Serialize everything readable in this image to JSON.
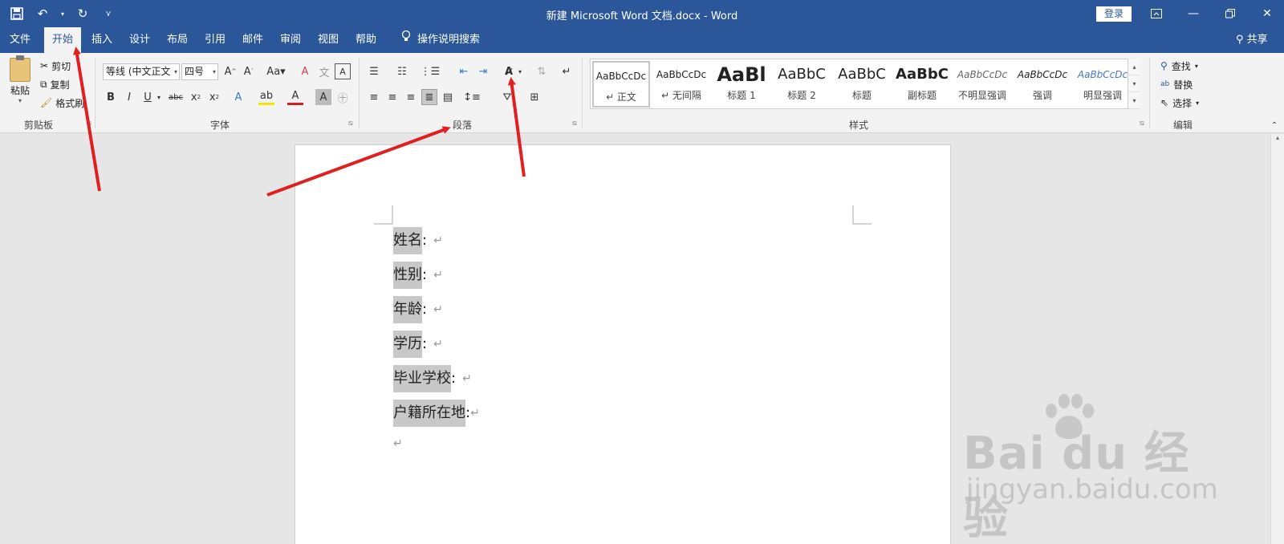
{
  "titlebar": {
    "doc_title": "新建 Microsoft Word 文档.docx  -  Word",
    "login": "登录",
    "bg": "#2b579a"
  },
  "menu": {
    "tabs": [
      "文件",
      "开始",
      "插入",
      "设计",
      "布局",
      "引用",
      "邮件",
      "审阅",
      "视图",
      "帮助"
    ],
    "active": "开始",
    "tell_me": "操作说明搜索",
    "share": "共享"
  },
  "clipboard": {
    "paste": "粘贴",
    "cut": "剪切",
    "copy": "复制",
    "format_painter": "格式刷",
    "group": "剪贴板"
  },
  "font": {
    "name": "等线 (中文正文",
    "size": "四号",
    "group": "字体"
  },
  "paragraph": {
    "group": "段落"
  },
  "styles": {
    "group": "样式",
    "items": [
      {
        "preview": "AaBbCcDc",
        "name": "↵ 正文"
      },
      {
        "preview": "AaBbCcDc",
        "name": "↵ 无间隔"
      },
      {
        "preview": "AaBl",
        "name": "标题 1"
      },
      {
        "preview": "AaBbC",
        "name": "标题 2"
      },
      {
        "preview": "AaBbC",
        "name": "标题"
      },
      {
        "preview": "AaBbC",
        "name": "副标题"
      },
      {
        "preview": "AaBbCcDc",
        "name": "不明显强调"
      },
      {
        "preview": "AaBbCcDc",
        "name": "强调"
      },
      {
        "preview": "AaBbCcDc",
        "name": "明显强调"
      }
    ]
  },
  "editing": {
    "find": "查找",
    "replace": "替换",
    "select": "选择",
    "group": "编辑"
  },
  "document": {
    "lines": [
      "姓名",
      "性别",
      "年龄",
      "学历",
      "毕业学校",
      "户籍所在地"
    ],
    "colon": ":",
    "para_mark": "↵"
  },
  "watermark": {
    "main": "Bai du 经验",
    "sub": "jingyan.baidu.com"
  },
  "colors": {
    "arrow": "#e02020",
    "highlight": "#c8c8c8"
  }
}
